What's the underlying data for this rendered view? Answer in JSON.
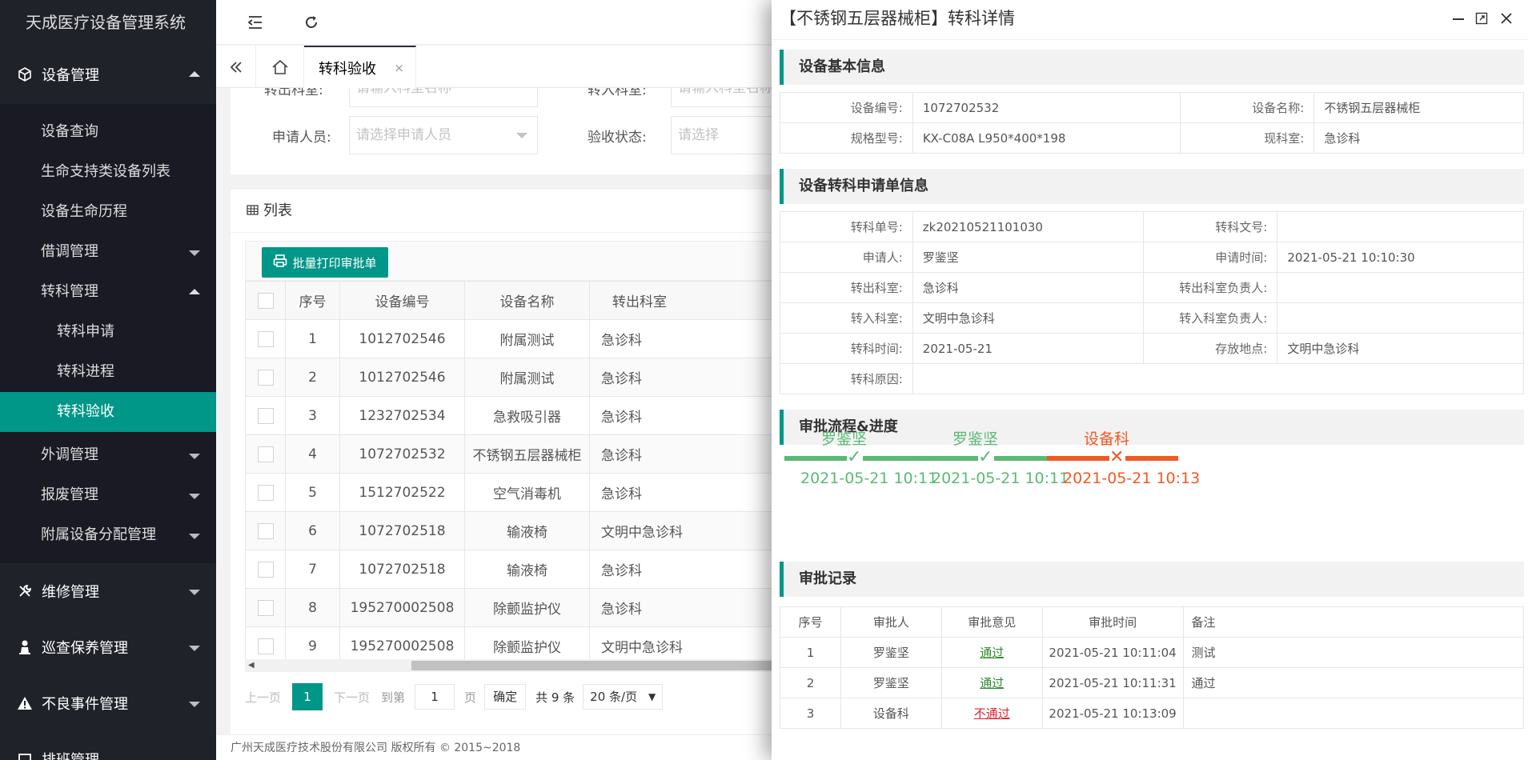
{
  "app": {
    "title": "天成医疗设备管理系统"
  },
  "sidebar": {
    "device_mgmt": "设备管理",
    "sub": [
      "设备查询",
      "生命支持类设备列表",
      "设备生命历程",
      "借调管理",
      "转科管理"
    ],
    "transfer_sub": [
      "转科申请",
      "转科进程",
      "转科验收"
    ],
    "sub_after": [
      "外调管理",
      "报废管理",
      "附属设备分配管理"
    ],
    "top_items": [
      "维修管理",
      "巡查保养管理",
      "不良事件管理",
      "排班管理"
    ]
  },
  "tabs": {
    "active": "转科验收",
    "close": "×"
  },
  "filter": {
    "out_dept_label": "转出科室:",
    "out_dept_placeholder": "请输入科室名称",
    "in_dept_label": "转入科室:",
    "in_dept_placeholder": "请输入科室名称",
    "applicant_label": "申请人员:",
    "applicant_placeholder": "请选择申请人员",
    "status_label": "验收状态:",
    "status_placeholder": "请选择"
  },
  "list": {
    "title": "列表",
    "print_button": "批量打印审批单",
    "columns": [
      "序号",
      "设备编号",
      "设备名称",
      "转出科室"
    ],
    "rows": [
      [
        "1",
        "1012702546",
        "附属测试",
        "急诊科"
      ],
      [
        "2",
        "1012702546",
        "附属测试",
        "急诊科"
      ],
      [
        "3",
        "1232702534",
        "急救吸引器",
        "急诊科"
      ],
      [
        "4",
        "1072702532",
        "不锈钢五层器械柜",
        "急诊科"
      ],
      [
        "5",
        "1512702522",
        "空气消毒机",
        "急诊科"
      ],
      [
        "6",
        "1072702518",
        "输液椅",
        "文明中急诊科"
      ],
      [
        "7",
        "1072702518",
        "输液椅",
        "急诊科"
      ],
      [
        "8",
        "195270002508",
        "除颤监护仪",
        "急诊科"
      ],
      [
        "9",
        "195270002508",
        "除颤监护仪",
        "文明中急诊科"
      ]
    ]
  },
  "pager": {
    "prev": "上一页",
    "current": "1",
    "next": "下一页",
    "goto": "到第",
    "goto_value": "1",
    "page_unit": "页",
    "confirm": "确定",
    "total": "共 9 条",
    "page_size": "20 条/页"
  },
  "footer": {
    "copyright": "广州天成医疗技术股份有限公司 版权所有 © 2015~2018"
  },
  "modal": {
    "title": "【不锈钢五层器械柜】转科详情",
    "basic_title": "设备基本信息",
    "basic": {
      "code_label": "设备编号:",
      "code": "1072702532",
      "name_label": "设备名称:",
      "name": "不锈钢五层器械柜",
      "model_label": "规格型号:",
      "model": "KX-C08A L950*400*198",
      "dept_label": "现科室:",
      "dept": "急诊科"
    },
    "apply_title": "设备转科申请单信息",
    "apply": {
      "no_label": "转科单号:",
      "no": "zk20210521101030",
      "doc_label": "转科文号:",
      "doc": "",
      "applicant_label": "申请人:",
      "applicant": "罗鉴坚",
      "time_label": "申请时间:",
      "time": "2021-05-21 10:10:30",
      "out_label": "转出科室:",
      "out": "急诊科",
      "out_head_label": "转出科室负责人:",
      "out_head": "",
      "in_label": "转入科室:",
      "in": "文明中急诊科",
      "in_head_label": "转入科室负责人:",
      "in_head": "",
      "date_label": "转科时间:",
      "date": "2021-05-21",
      "place_label": "存放地点:",
      "place": "文明中急诊科",
      "reason_label": "转科原因:",
      "reason": ""
    },
    "flow_title": "审批流程&进度",
    "flow": [
      {
        "name": "罗鉴坚",
        "time": "2021-05-21 10:11",
        "status": "pass",
        "color": "#5bb974"
      },
      {
        "name": "罗鉴坚",
        "time": "2021-05-21 10:11",
        "status": "pass",
        "color": "#5bb974"
      },
      {
        "name": "设备科",
        "time": "2021-05-21 10:13",
        "status": "fail",
        "color": "#f15a24"
      }
    ],
    "record_title": "审批记录",
    "record_columns": [
      "序号",
      "审批人",
      "审批意见",
      "审批时间",
      "备注"
    ],
    "records": [
      {
        "no": "1",
        "person": "罗鉴坚",
        "opinion": "通过",
        "time": "2021-05-21 10:11:04",
        "note": "测试"
      },
      {
        "no": "2",
        "person": "罗鉴坚",
        "opinion": "通过",
        "time": "2021-05-21 10:11:31",
        "note": "通过"
      },
      {
        "no": "3",
        "person": "设备科",
        "opinion": "不通过",
        "time": "2021-05-21 10:13:09",
        "note": ""
      }
    ]
  },
  "colors": {
    "accent": "#009688",
    "sidebar": "#20222a",
    "pass": "#5bb974",
    "fail": "#f15a24"
  }
}
